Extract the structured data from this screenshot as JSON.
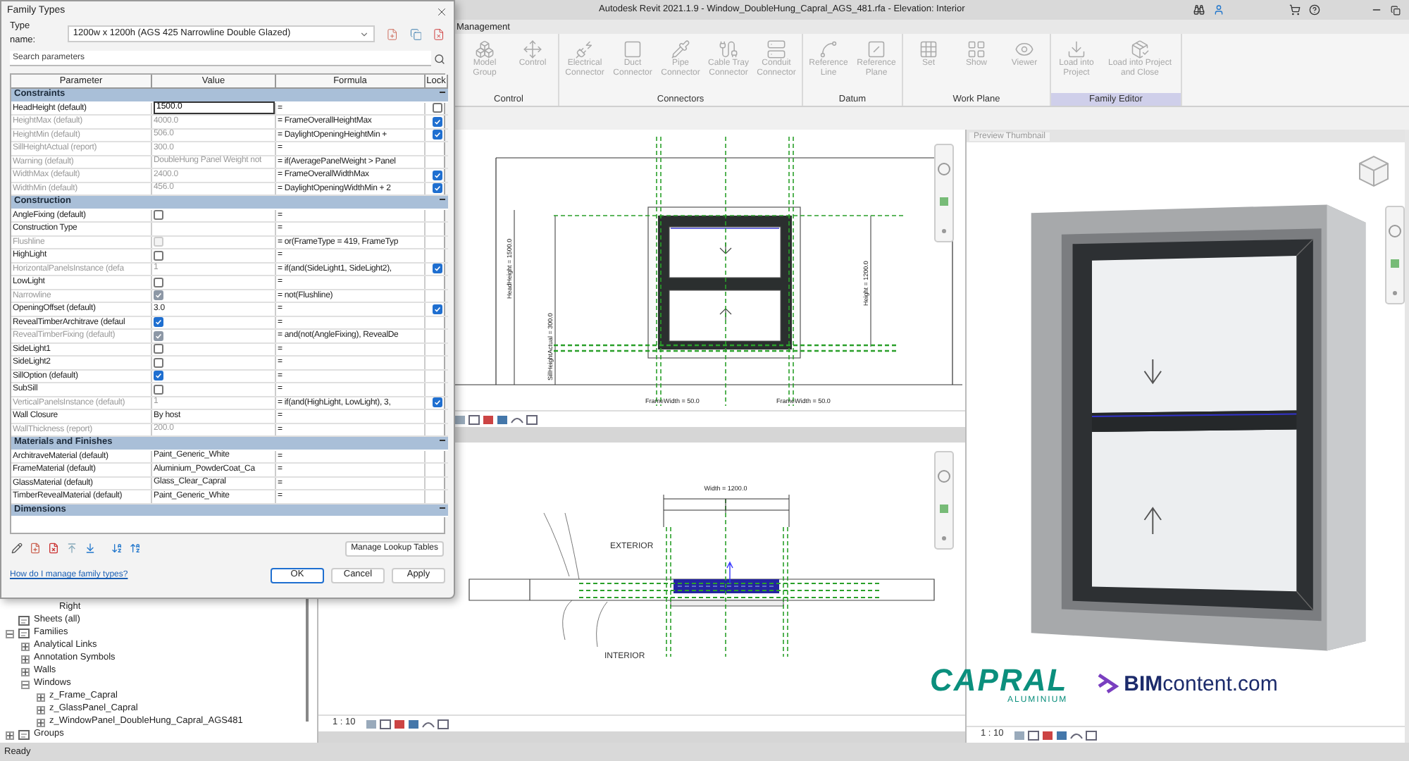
{
  "title_bar": {
    "title": "Autodesk Revit 2021.1.9 - Window_DoubleHung_Capral_AGS_481.rfa - Elevation: Interior"
  },
  "ribbon": {
    "tab": "Management",
    "groups": [
      {
        "label": "Control",
        "tools": [
          {
            "label": "Model Group",
            "disabled": true
          },
          {
            "label": "Control",
            "disabled": true
          }
        ]
      },
      {
        "label": "Connectors",
        "tools": [
          {
            "label": "Electrical Connector",
            "disabled": true
          },
          {
            "label": "Duct Connector",
            "disabled": true
          },
          {
            "label": "Pipe Connector",
            "disabled": true
          },
          {
            "label": "Cable Tray Connector",
            "disabled": true
          },
          {
            "label": "Conduit Connector",
            "disabled": true
          }
        ]
      },
      {
        "label": "Datum",
        "tools": [
          {
            "label": "Reference Line",
            "disabled": true
          },
          {
            "label": "Reference Plane",
            "disabled": true
          }
        ]
      },
      {
        "label": "Work Plane",
        "tools": [
          {
            "label": "Set",
            "disabled": true
          },
          {
            "label": "Show",
            "disabled": true
          },
          {
            "label": "Viewer",
            "disabled": true
          }
        ]
      },
      {
        "label": "Family Editor",
        "highlighted": true,
        "tools": [
          {
            "label": "Load into Project",
            "disabled": true
          },
          {
            "label": "Load into Project and Close",
            "disabled": true
          }
        ]
      }
    ]
  },
  "project_browser": {
    "continued_items": [
      "Right"
    ],
    "items": [
      {
        "label": "Sheets (all)"
      },
      {
        "label": "Families",
        "expanded": true,
        "children": [
          {
            "label": "Analytical Links",
            "expanded": false
          },
          {
            "label": "Annotation Symbols",
            "expanded": false
          },
          {
            "label": "Walls",
            "expanded": false
          },
          {
            "label": "Windows",
            "expanded": true,
            "children": [
              {
                "label": "z_Frame_Capral",
                "expanded": false
              },
              {
                "label": "z_GlassPanel_Capral",
                "expanded": false
              },
              {
                "label": "z_WindowPanel_DoubleHung_Capral_AGS481",
                "expanded": false
              }
            ]
          }
        ]
      },
      {
        "label": "Groups",
        "expanded": false
      }
    ]
  },
  "elevation_view": {
    "labels": [
      "HeadHeight = 1500.0",
      "SillHeightActual = 300.0",
      "Height = 1200.0",
      "FrameWidth = 50.0",
      "FrameWidth = 50.0"
    ]
  },
  "plan_view": {
    "width_label": "Width = 1200.0",
    "exterior": "EXTERIOR",
    "interior": "INTERIOR",
    "scale": "1 : 10"
  },
  "preview_view": {
    "title": "Preview Thumbnail",
    "scale": "1 : 10"
  },
  "logos": {
    "capral": "CAPRAL",
    "capral_sub": "ALUMINIUM",
    "bim": "**BIM**content.com"
  },
  "status_bar": {
    "text": "Ready"
  },
  "dialog": {
    "title": "Family Types",
    "type_label": "Type name:",
    "type_value": "1200w x 1200h (AGS 425 Narrowline Double Glazed)",
    "search_placeholder": "Search parameters",
    "columns": [
      "Parameter",
      "Value",
      "Formula",
      "Lock"
    ],
    "groups": [
      {
        "name": "Constraints",
        "rows": [
          {
            "name": "HeadHeight (default)",
            "kind": "field",
            "value": "1500.0",
            "formula": "=",
            "disabled": false,
            "lock": false
          },
          {
            "name": "HeightMax (default)",
            "kind": "text",
            "value": "4000.0",
            "formula": "= FrameOverallHeightMax",
            "disabled": true,
            "lock": true
          },
          {
            "name": "HeightMin (default)",
            "kind": "text",
            "value": "506.0",
            "formula": "= DaylightOpeningHeightMin +",
            "disabled": true,
            "lock": true
          },
          {
            "name": "SillHeightActual (report)",
            "kind": "text",
            "value": "300.0",
            "formula": "=",
            "disabled": true
          },
          {
            "name": "Warning (default)",
            "kind": "text",
            "value": "DoubleHung Panel Weight not",
            "formula": "= if(AveragePanelWeight > Panel",
            "disabled": true
          },
          {
            "name": "WidthMax (default)",
            "kind": "text",
            "value": "2400.0",
            "formula": "= FrameOverallWidthMax",
            "disabled": true,
            "lock": true
          },
          {
            "name": "WidthMin (default)",
            "kind": "text",
            "value": "456.0",
            "formula": "= DaylightOpeningWidthMin + 2",
            "disabled": true,
            "lock": true
          }
        ]
      },
      {
        "name": "Construction",
        "rows": [
          {
            "name": "AngleFixing (default)",
            "kind": "checkbox",
            "checked": false,
            "formula": "=",
            "disabled": false
          },
          {
            "name": "Construction Type",
            "kind": "text",
            "formula": "=",
            "disabled": false
          },
          {
            "name": "Flushline",
            "kind": "checkbox",
            "checked": false,
            "formula": "= or(FrameType = 419, FrameTyp",
            "disabled": true
          },
          {
            "name": "HighLight",
            "kind": "checkbox",
            "checked": false,
            "formula": "=",
            "disabled": false
          },
          {
            "name": "HorizontalPanelsInstance (defa",
            "kind": "text",
            "value": "1",
            "formula": "= if(and(SideLight1, SideLight2),",
            "disabled": true,
            "lock": true
          },
          {
            "name": "LowLight",
            "kind": "checkbox",
            "checked": false,
            "formula": "=",
            "disabled": false
          },
          {
            "name": "Narrowline",
            "kind": "checkbox",
            "checked": true,
            "formula": "= not(Flushline)",
            "disabled": true
          },
          {
            "name": "OpeningOffset (default)",
            "kind": "text",
            "value": "3.0",
            "formula": "=",
            "disabled": false,
            "lock": true
          },
          {
            "name": "RevealTimberArchitrave (defaul",
            "kind": "checkbox",
            "checked": true,
            "formula": "=",
            "disabled": false
          },
          {
            "name": "RevealTimberFixing (default)",
            "kind": "checkbox",
            "checked": true,
            "formula": "= and(not(AngleFixing), RevealDe",
            "disabled": true
          },
          {
            "name": "SideLight1",
            "kind": "checkbox",
            "checked": false,
            "formula": "=",
            "disabled": false
          },
          {
            "name": "SideLight2",
            "kind": "checkbox",
            "checked": false,
            "formula": "=",
            "disabled": false
          },
          {
            "name": "SillOption (default)",
            "kind": "checkbox",
            "checked": true,
            "formula": "=",
            "disabled": false
          },
          {
            "name": "SubSill",
            "kind": "checkbox",
            "checked": false,
            "formula": "=",
            "disabled": false
          },
          {
            "name": "VerticalPanelsInstance (default)",
            "kind": "text",
            "value": "1",
            "formula": "= if(and(HighLight, LowLight), 3,",
            "disabled": true,
            "lock": true
          },
          {
            "name": "Wall Closure",
            "kind": "text",
            "value": "By host",
            "formula": "=",
            "disabled": false
          },
          {
            "name": "WallThickness (report)",
            "kind": "text",
            "value": "200.0",
            "formula": "=",
            "disabled": true
          }
        ]
      },
      {
        "name": "Materials and Finishes",
        "rows": [
          {
            "name": "ArchitraveMaterial (default)",
            "kind": "text",
            "value": "Paint_Generic_White",
            "formula": "=",
            "disabled": false
          },
          {
            "name": "FrameMaterial (default)",
            "kind": "text",
            "value": "Aluminium_PowderCoat_Ca",
            "formula": "=",
            "disabled": false
          },
          {
            "name": "GlassMaterial (default)",
            "kind": "text",
            "value": "Glass_Clear_Capral",
            "formula": "=",
            "disabled": false
          },
          {
            "name": "TimberRevealMaterial (default)",
            "kind": "text",
            "value": "Paint_Generic_White",
            "formula": "=",
            "disabled": false
          }
        ]
      },
      {
        "name": "Dimensions"
      }
    ],
    "manage_button": "Manage Lookup Tables",
    "help_link": "How do I manage family types?",
    "buttons": [
      "OK",
      "Cancel",
      "Apply"
    ]
  }
}
